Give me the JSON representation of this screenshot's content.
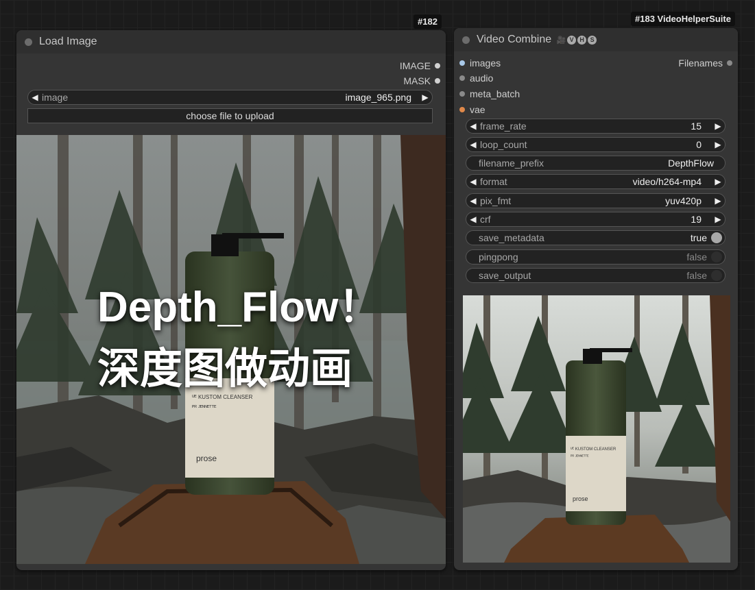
{
  "load_image": {
    "id_badge": "#182",
    "title": "Load Image",
    "outputs": [
      "IMAGE",
      "MASK"
    ],
    "image_widget": {
      "label": "image",
      "value": "image_965.png"
    },
    "upload_label": "choose file to upload",
    "overlay": {
      "line1": "Depth_Flow！",
      "line2": "深度图做动画"
    }
  },
  "video_combine": {
    "id_badge": "#183 VideoHelperSuite",
    "title": "Video Combine",
    "header_icons": [
      "camera-icon",
      "V",
      "H",
      "S"
    ],
    "inputs": [
      {
        "label": "images",
        "color": "#a8c8e8"
      },
      {
        "label": "audio",
        "color": "#8a8a8a"
      },
      {
        "label": "meta_batch",
        "color": "#8a8a8a"
      },
      {
        "label": "vae",
        "color": "#e0894a"
      }
    ],
    "output": "Filenames",
    "widgets": [
      {
        "label": "frame_rate",
        "value": "15"
      },
      {
        "label": "loop_count",
        "value": "0"
      },
      {
        "label": "filename_prefix",
        "value": "DepthFlow"
      },
      {
        "label": "format",
        "value": "video/h264-mp4"
      },
      {
        "label": "pix_fmt",
        "value": "yuv420p"
      },
      {
        "label": "crf",
        "value": "19"
      },
      {
        "label": "save_metadata",
        "value": "true"
      },
      {
        "label": "pingpong",
        "value": "false"
      },
      {
        "label": "save_output",
        "value": "false"
      }
    ],
    "preview_text": {
      "label1": "ᵁᴱ KUSTOM CLEANSER",
      "label2": "ᴾᴿ ᴶᴱᴺᴺᴱᵀᵀᴱ",
      "brand": "prose"
    }
  },
  "main_text": {
    "label1": "ᵁᴱ KUSTOM CLEANSER",
    "label2": "ᴾᴿ ᴶᴱᴺᴺᴱᵀᵀᴱ",
    "brand": "prose"
  }
}
